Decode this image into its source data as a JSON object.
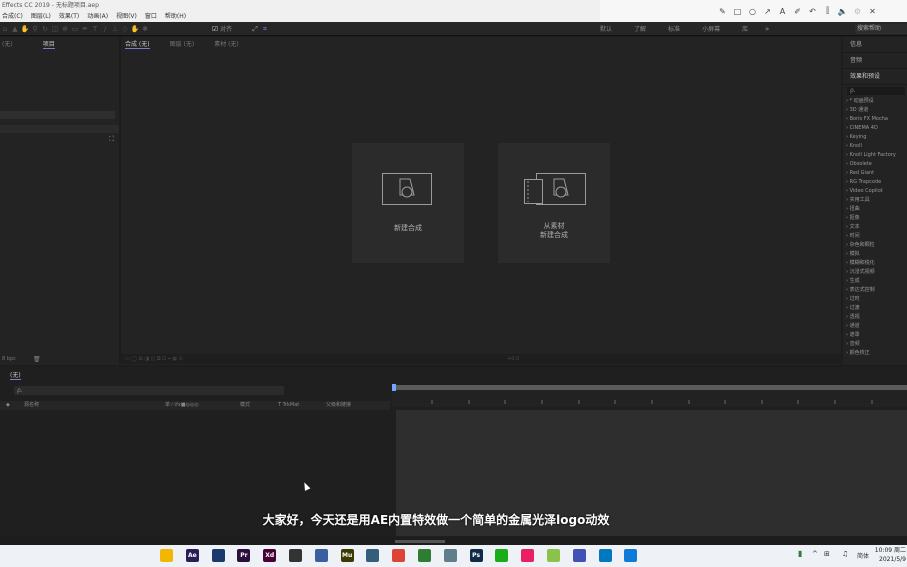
{
  "window": {
    "title": "Effects CC 2019 - 无标题项目.aep"
  },
  "menu": [
    "合成(C)",
    "图层(L)",
    "效果(T)",
    "动画(A)",
    "视图(V)",
    "窗口",
    "帮助(H)"
  ],
  "annotation_toolbar": [
    "pen-icon",
    "rectangle-icon",
    "ellipse-icon",
    "arrow-icon",
    "text-icon",
    "highlighter-icon",
    "undo-icon",
    "pin-icon",
    "volume-icon",
    "close-icon"
  ],
  "toolbar": {
    "snap_label": "对齐",
    "workspaces": [
      "默认",
      "了解",
      "标准",
      "小屏幕",
      "库"
    ],
    "search_placeholder": "搜索帮助"
  },
  "project_panel": {
    "tabs": [
      "(无)",
      "项目"
    ],
    "bpc": "8 bpc"
  },
  "viewer": {
    "tabs": [
      "合成 (无)",
      "图层 (无)",
      "素材 (无)"
    ],
    "new_comp_label": "新建合成",
    "from_footage_label_1": "从素材",
    "from_footage_label_2": "新建合成",
    "footer_zoom": "+0.0"
  },
  "effects_panel": {
    "headers": [
      "信息",
      "音频",
      "效果和预设"
    ],
    "search_placeholder": "ρ.",
    "items": [
      "* 动画预设",
      "3D 通道",
      "Boris FX Mocha",
      "CINEMA 4D",
      "Keying",
      "Knoll",
      "Knoll Light Factory",
      "Obsolete",
      "Red Giant",
      "RG Trapcode",
      "Video Copilot",
      "实用工具",
      "扭曲",
      "抠像",
      "文本",
      "时间",
      "杂色和颗粒",
      "模拟",
      "模糊和锐化",
      "沉浸式视频",
      "生成",
      "表达式控制",
      "过时",
      "过渡",
      "透视",
      "通道",
      "遮罩",
      "音频",
      "颜色校正"
    ]
  },
  "timeline": {
    "tab": "(无)",
    "search_placeholder": "ρ.",
    "columns": [
      "源名称",
      "单☆\\fx■◎◎◎",
      "模式",
      "T TrkMat",
      "父级和链接"
    ]
  },
  "subtitle": "大家好，今天还是用AE内置特效做一个简单的金属光泽logo动效",
  "taskbar": {
    "apps": [
      {
        "name": "file-explorer-icon",
        "label": "",
        "color": "#f2b705"
      },
      {
        "name": "after-effects-icon",
        "label": "Ae",
        "color": "#2b1d57"
      },
      {
        "name": "cinema4d-icon",
        "label": "",
        "color": "#1b3a6b"
      },
      {
        "name": "premiere-icon",
        "label": "Pr",
        "color": "#2b0f3f"
      },
      {
        "name": "xd-icon",
        "label": "Xd",
        "color": "#470137"
      },
      {
        "name": "figma-icon",
        "label": "",
        "color": "#333333"
      },
      {
        "name": "blender-icon",
        "label": "",
        "color": "#3a5fa0"
      },
      {
        "name": "muse-icon",
        "label": "Mu",
        "color": "#3b3b00"
      },
      {
        "name": "app-icon",
        "label": "",
        "color": "#355e7a"
      },
      {
        "name": "chrome-icon",
        "label": "",
        "color": "#db4437"
      },
      {
        "name": "maps-icon",
        "label": "",
        "color": "#2e7d32"
      },
      {
        "name": "capture-icon",
        "label": "",
        "color": "#607d8b"
      },
      {
        "name": "photoshop-icon",
        "label": "Ps",
        "color": "#0f2b46"
      },
      {
        "name": "wechat-icon",
        "label": "",
        "color": "#1aad19"
      },
      {
        "name": "browser-icon",
        "label": "",
        "color": "#e91e63"
      },
      {
        "name": "green-app-icon",
        "label": "",
        "color": "#8bc34a"
      },
      {
        "name": "calculator-icon",
        "label": "",
        "color": "#3f51b5"
      },
      {
        "name": "desktop-icon",
        "label": "",
        "color": "#0277bd"
      },
      {
        "name": "edge-icon",
        "label": "",
        "color": "#0f7bd7"
      }
    ],
    "ime": "简体",
    "time": "10:09 周二",
    "date": "2021/5/9"
  }
}
